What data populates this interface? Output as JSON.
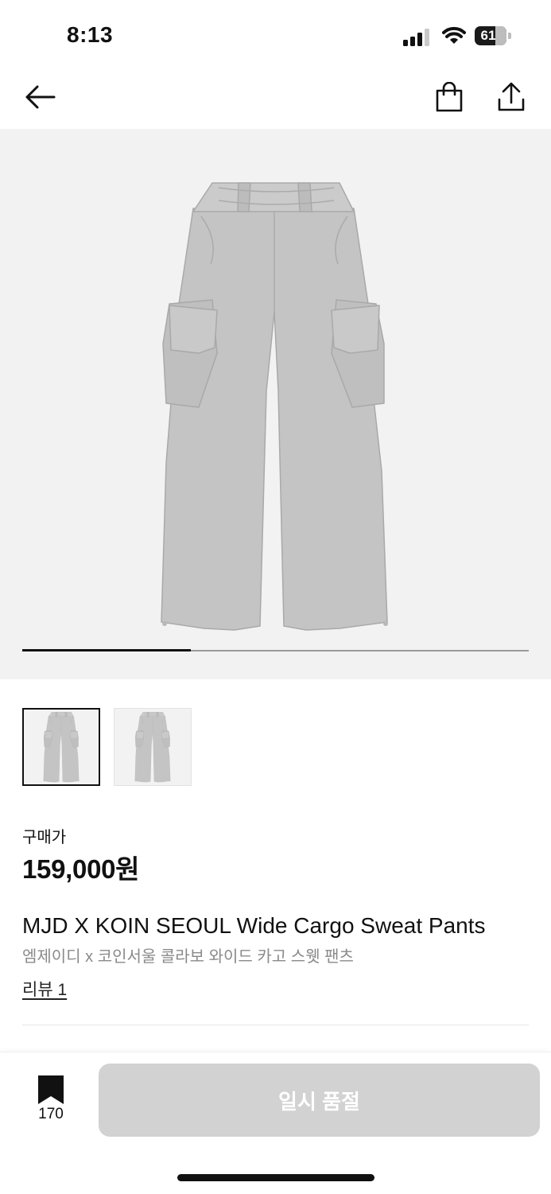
{
  "status_bar": {
    "time": "8:13",
    "battery_level": "61",
    "icons": [
      "signal-icon",
      "wifi-icon",
      "battery-icon"
    ]
  },
  "nav": {
    "icons": [
      "back-arrow-icon",
      "shopping-bag-icon",
      "share-icon"
    ]
  },
  "gallery": {
    "image": "gray-wide-cargo-sweat-pants",
    "current_slide": 1,
    "total_slides": 3
  },
  "thumbnails": [
    {
      "image": "gray-wide-cargo-sweat-pants",
      "selected": true
    },
    {
      "image": "gray-wide-cargo-sweat-pants",
      "selected": false
    }
  ],
  "product": {
    "price_label": "구매가",
    "price": "159,000원",
    "title": "MJD X KOIN SEOUL Wide Cargo Sweat Pants",
    "subtitle": "엠제이디 x 코인서울 콜라보 와이드 카고 스웻 팬츠",
    "review_link": "리뷰 1"
  },
  "bottom_bar": {
    "bookmark_count": "170",
    "action_label": "일시 품절"
  },
  "colors": {
    "background": "#ffffff",
    "gallery_bg": "#f2f2f2",
    "button_disabled": "#d2d2d2",
    "text": "#111111",
    "subtext": "#8a8a8a"
  }
}
